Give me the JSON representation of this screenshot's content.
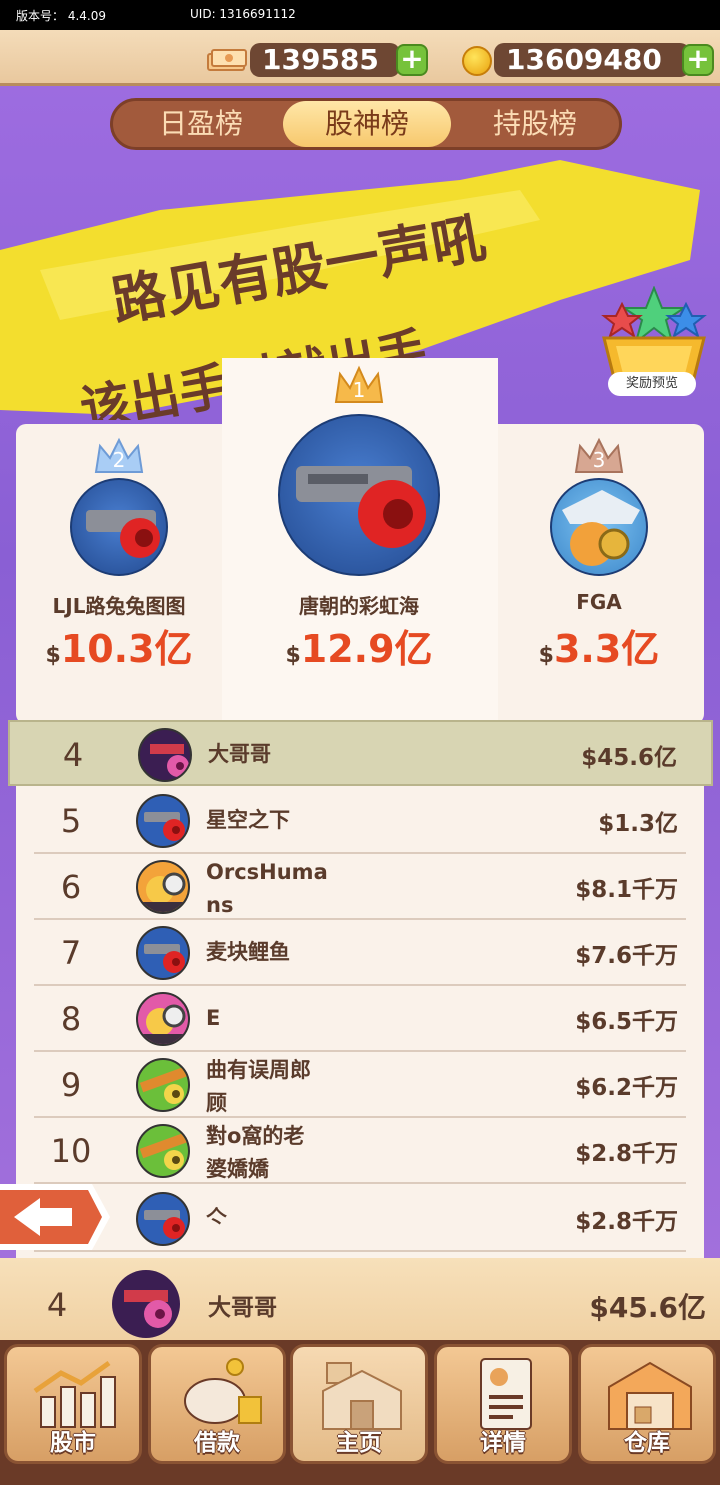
{
  "status_bar": {
    "version": "版本号： 4.4.09",
    "uid": "UID: 1316691112"
  },
  "currency": {
    "cash": "139585",
    "coins": "13609480",
    "plus": "+"
  },
  "tabs": [
    {
      "label": "日盈榜",
      "active": false
    },
    {
      "label": "股神榜",
      "active": true
    },
    {
      "label": "持股榜",
      "active": false
    }
  ],
  "banner": {
    "line1": "路见有股一声吼",
    "line2": "该出手时就出手"
  },
  "reward_preview": "奖励预览",
  "podium": [
    {
      "rank": "2",
      "name": "LJL路兔兔图图",
      "currency_sign": "$",
      "value": "10.3亿"
    },
    {
      "rank": "1",
      "name": "唐朝的彩虹海",
      "currency_sign": "$",
      "value": "12.9亿"
    },
    {
      "rank": "3",
      "name": "FGA",
      "currency_sign": "$",
      "value": "3.3亿"
    }
  ],
  "list": [
    {
      "rank": "4",
      "name": "大哥哥",
      "value": "$45.6亿",
      "highlight": true
    },
    {
      "rank": "5",
      "name": "星空之下",
      "value": "$1.3亿"
    },
    {
      "rank": "6",
      "name": "OrcsHuma\nns",
      "value": "$8.1千万"
    },
    {
      "rank": "7",
      "name": "麦块鲤鱼",
      "value": "$7.6千万"
    },
    {
      "rank": "8",
      "name": "E",
      "value": "$6.5千万"
    },
    {
      "rank": "9",
      "name": "曲有误周郎\n顾",
      "value": "$6.2千万"
    },
    {
      "rank": "10",
      "name": "對o窩的老\n婆嬌嬌",
      "value": "$2.8千万"
    },
    {
      "rank": "",
      "name": "亽",
      "value": "$2.8千万"
    }
  ],
  "my_rank": {
    "rank": "4",
    "name": "大哥哥",
    "value": "$45.6亿"
  },
  "nav": [
    {
      "label": "股市",
      "icon": "stock-chart-icon"
    },
    {
      "label": "借款",
      "icon": "piggy-bank-icon"
    },
    {
      "label": "主页",
      "icon": "home-icon",
      "active": true
    },
    {
      "label": "详情",
      "icon": "profile-card-icon"
    },
    {
      "label": "仓库",
      "icon": "warehouse-icon"
    }
  ],
  "colors": {
    "accent_red": "#e64a22",
    "brown_text": "#5a3b2b",
    "purple_bg": "#8e63d6"
  }
}
